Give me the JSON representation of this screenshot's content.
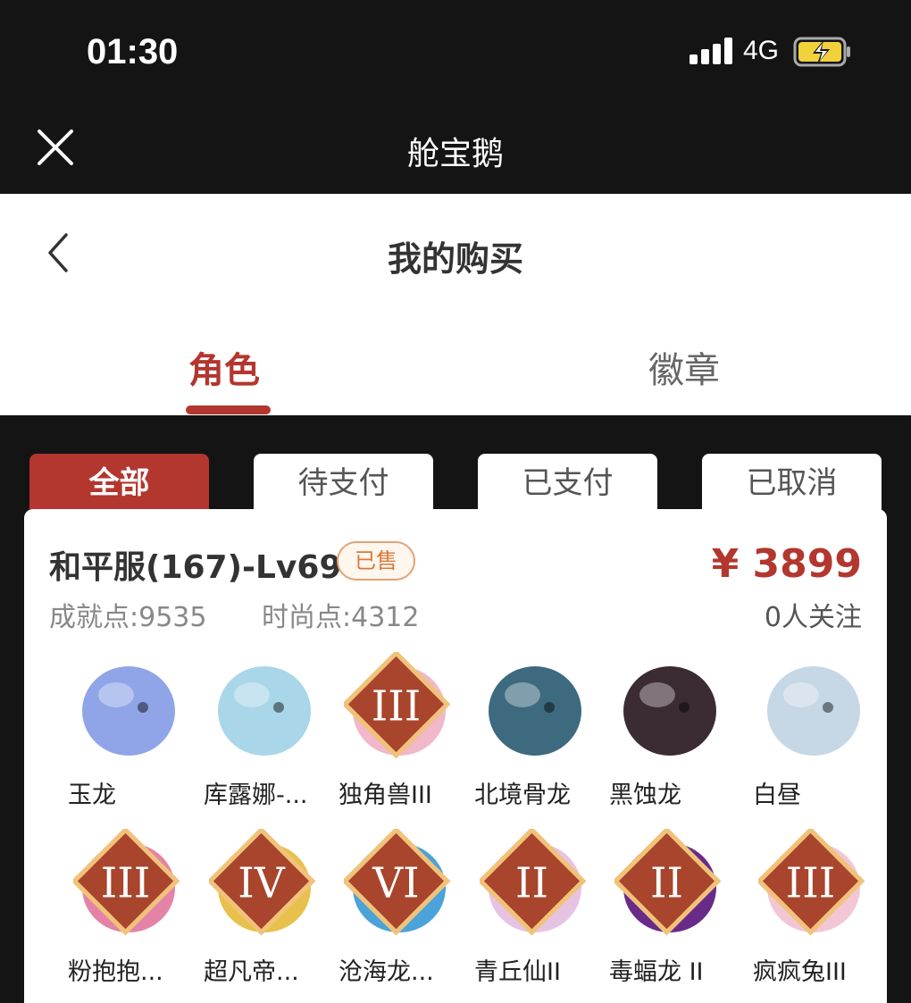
{
  "status_bar": {
    "time": "01:30",
    "network": "4G"
  },
  "app": {
    "title": "舱宝鹅"
  },
  "page": {
    "title": "我的购买"
  },
  "main_tabs": [
    {
      "label": "角色",
      "active": true
    },
    {
      "label": "徽章",
      "active": false
    }
  ],
  "filters": [
    {
      "label": "全部",
      "active": true
    },
    {
      "label": "待支付",
      "active": false
    },
    {
      "label": "已支付",
      "active": false
    },
    {
      "label": "已取消",
      "active": false
    }
  ],
  "order": {
    "server": "和平服(167)-Lv69",
    "status_badge": "已售",
    "price": "¥ 3899",
    "achievement": "成就点:9535",
    "fashion": "时尚点:4312",
    "followers": "0人关注",
    "items": [
      {
        "name": "玉龙",
        "icon": "jade-dragon-icon",
        "color": "#8fa5e8",
        "tier": ""
      },
      {
        "name": "库露娜-...",
        "icon": "kuluna-icon",
        "color": "#a9d6e8",
        "tier": ""
      },
      {
        "name": "独角兽III",
        "icon": "unicorn-icon",
        "color": "#f1b8c9",
        "tier": "III"
      },
      {
        "name": "北境骨龙",
        "icon": "bone-dragon-icon",
        "color": "#3d6a7e",
        "tier": ""
      },
      {
        "name": "黑蚀龙",
        "icon": "black-dragon-icon",
        "color": "#3b2b33",
        "tier": ""
      },
      {
        "name": "白昼",
        "icon": "white-dragon-icon",
        "color": "#c6d7e6",
        "tier": ""
      },
      {
        "name": "粉抱抱...",
        "icon": "pink-bear-icon",
        "color": "#e483a7",
        "tier": "III"
      },
      {
        "name": "超凡帝...",
        "icon": "emperor-icon",
        "color": "#e8c14c",
        "tier": "IV"
      },
      {
        "name": "沧海龙...",
        "icon": "sea-dragon-icon",
        "color": "#4aa3d9",
        "tier": "VI"
      },
      {
        "name": "青丘仙II",
        "icon": "fox-fairy-icon",
        "color": "#e7c3e3",
        "tier": "II"
      },
      {
        "name": "毒蝠龙 II",
        "icon": "poison-bat-dragon-icon",
        "color": "#6a2a8a",
        "tier": "II"
      },
      {
        "name": "疯疯兔III",
        "icon": "crazy-rabbit-icon",
        "color": "#f3c6d6",
        "tier": "III"
      }
    ]
  }
}
